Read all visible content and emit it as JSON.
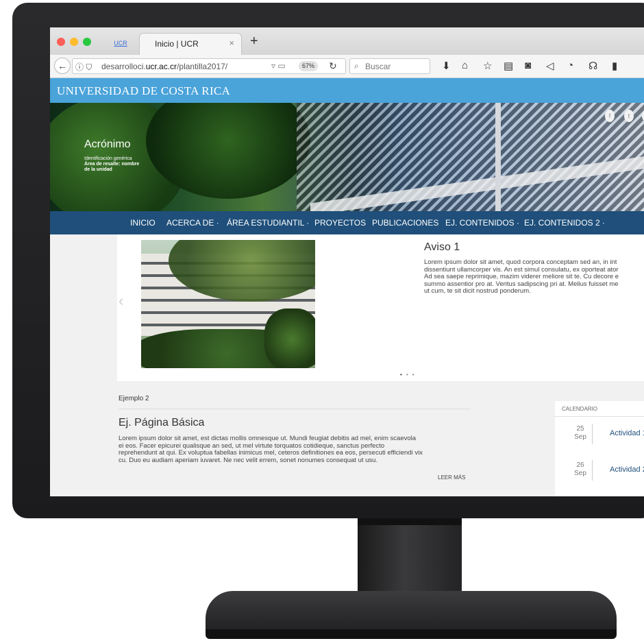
{
  "browser": {
    "tab_small_label": "UCR",
    "tab_title": "Inicio | UCR",
    "tab_close": "×",
    "new_tab": "+",
    "url_host_prefix": "desarrolloci.",
    "url_host": "ucr.ac.cr",
    "url_path": "/plantilla2017/",
    "zoom": "67%",
    "search_placeholder": "Buscar",
    "toolbar_icons": [
      "download-icon",
      "home-icon",
      "bookmark-star-icon",
      "library-icon",
      "pocket-icon",
      "send-icon",
      "history-icon",
      "extension-icon",
      "clipboard-icon"
    ]
  },
  "site": {
    "brand": "UNIVERSIDAD DE COSTA RICA",
    "hero_title": "Acrónimo",
    "hero_sub1": "Identificación genérica",
    "hero_sub2": "Área de resalte: nombre",
    "hero_sub3": "de la unidad",
    "social": [
      "f",
      "t",
      "▶"
    ]
  },
  "nav": [
    "INICIO",
    "ACERCA DE ·",
    "ÁREA ESTUDIANTIL ·",
    "PROYECTOS",
    "PUBLICACIONES",
    "EJ. CONTENIDOS ·",
    "EJ. CONTENIDOS 2 ·"
  ],
  "slider": {
    "title": "Aviso 1",
    "body": "Lorem ipsum dolor sit amet, quod corpora conceptam sed an, in int\ndissentiunt ullamcorper vis. An est simul consulatu, ex oporteat ator\nAd sea saepe reprimique, mazim viderer meliore sit te. Cu decore e\nsummo assentior pro at. Veritus sadipscing pri at. Melius fuisset me\nut cum, te sit dicit nostrud ponderum.",
    "prev": "‹",
    "dots": [
      "•",
      "•",
      "•"
    ]
  },
  "main": {
    "example_label": "Ejemplo 2",
    "title": "Ej. Página Básica",
    "body": "Lorem ipsum dolor sit amet, est dictas mollis omnesque ut. Mundi feugiat debitis ad mel, enim scaevola\nei eos. Facer epicurei qualisque an sed, ut mel virtute torquatos cotidieque, sanctus perfecto\nreprehendunt at qui. Ex voluptua fabellas inimicus mel, ceteros definitiones ea eos, persecuti efficiendi vix\ncu. Duo eu audiam aperiam iuvaret. Ne nec velit errem, sonet nonumes consequat ut usu.",
    "read_more": "LEER MÁS"
  },
  "calendar": {
    "header": "CALENDARIO",
    "events": [
      {
        "day": "25",
        "month": "Sep",
        "activity": "Actividad 1"
      },
      {
        "day": "26",
        "month": "Sep",
        "activity": "Actividad 2"
      }
    ]
  }
}
